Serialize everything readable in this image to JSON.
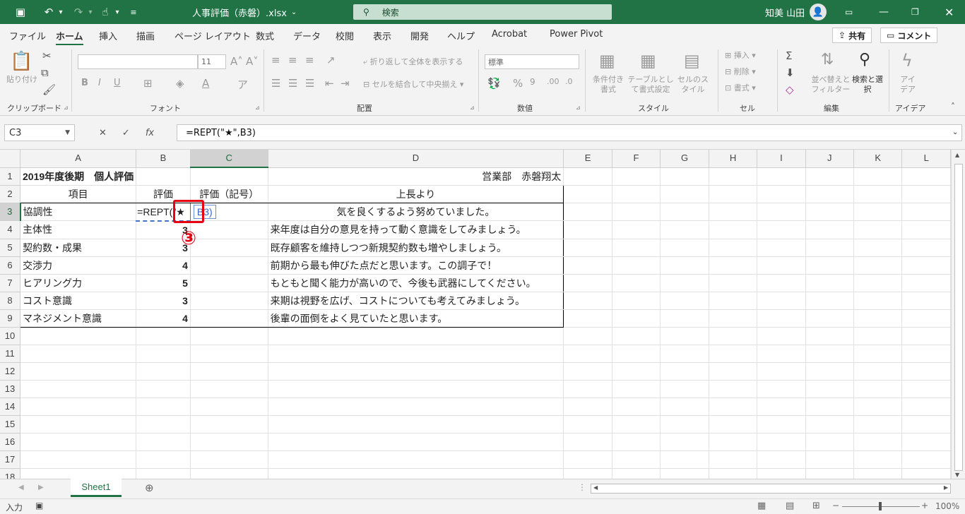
{
  "titlebar": {
    "filename": "人事評価（赤磐）.xlsx",
    "dropdown_arrow": "⌄",
    "search_placeholder": "検索",
    "user_name": "知美 山田"
  },
  "menu_tabs": [
    "ファイル",
    "ホーム",
    "挿入",
    "描画",
    "ページ レイアウト",
    "数式",
    "データ",
    "校閲",
    "表示",
    "開発",
    "ヘルプ",
    "Acrobat",
    "Power Pivot"
  ],
  "share_label": "共有",
  "comment_label": "コメント",
  "ribbon": {
    "clipboard": {
      "paste_label": "貼り付け",
      "group": "クリップボード"
    },
    "font": {
      "size": "11",
      "group": "フォント"
    },
    "alignment": {
      "wrap": "折り返して全体を表示する",
      "merge": "セルを結合して中央揃え",
      "group": "配置"
    },
    "number": {
      "format": "標準",
      "group": "数値"
    },
    "styles": {
      "cond": "条件付き書式",
      "table": "テーブルとして書式設定",
      "cell": "セルのスタイル",
      "group": "スタイル"
    },
    "cells": {
      "insert": "挿入",
      "delete": "削除",
      "format": "書式",
      "group": "セル"
    },
    "editing": {
      "sort": "並べ替えとフィルター",
      "find": "検索と選択",
      "group": "編集"
    },
    "ideas": {
      "label": "アイデア",
      "group": "アイデア"
    }
  },
  "name_box": "C3",
  "formula": "=REPT(\"★\",B3)",
  "columns": [
    "A",
    "B",
    "C",
    "D",
    "E",
    "F",
    "G",
    "H",
    "I",
    "J",
    "K",
    "L"
  ],
  "rows": {
    "r1": {
      "a": "2019年度後期　個人評価",
      "d": "営業部　赤磐翔太"
    },
    "r2": {
      "a": "項目",
      "b": "評価",
      "c": "評価（記号）",
      "d": "上長より"
    },
    "r3": {
      "a": "協調性",
      "b": "=REPT(\"★",
      "c": "B3)",
      "d": "気を良くするよう努めていました。"
    },
    "r4": {
      "a": "主体性",
      "b": "3",
      "d": "来年度は自分の意見を持って動く意識をしてみましょう。"
    },
    "r5": {
      "a": "契約数・成果",
      "b": "3",
      "d": "既存顧客を維持しつつ新規契約数も増やしましょう。"
    },
    "r6": {
      "a": "交渉力",
      "b": "4",
      "d": "前期から最も伸びた点だと思います。この調子で！"
    },
    "r7": {
      "a": "ヒアリング力",
      "b": "5",
      "d": "もともと聞く能力が高いので、今後も武器にしてください。"
    },
    "r8": {
      "a": "コスト意識",
      "b": "3",
      "d": "来期は視野を広げ、コストについても考えてみましょう。"
    },
    "r9": {
      "a": "マネジメント意識",
      "b": "4",
      "d": "後輩の面倒をよく見ていたと思います。"
    }
  },
  "row_numbers": [
    "1",
    "2",
    "3",
    "4",
    "5",
    "6",
    "7",
    "8",
    "9",
    "10",
    "11",
    "12",
    "13",
    "14",
    "15",
    "16",
    "17",
    "18"
  ],
  "annotation_step": "③",
  "sheet_tab": "Sheet1",
  "status": {
    "mode": "入力",
    "zoom": "100%"
  },
  "colors": {
    "excel_green": "#217346",
    "highlight_red": "#e60012",
    "ref_blue": "#4472c4"
  }
}
